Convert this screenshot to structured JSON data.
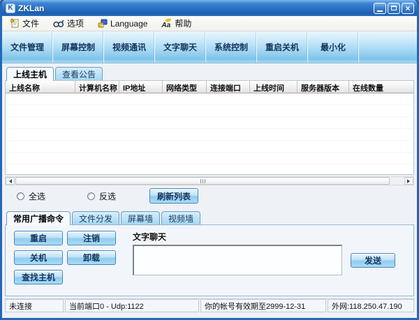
{
  "window": {
    "title": "ZKLan",
    "icon": "app-logo-K"
  },
  "titlebar": {
    "controls": [
      "minimize",
      "restore",
      "close"
    ]
  },
  "menu": {
    "items": [
      {
        "label": "文件",
        "icon": "document-icon"
      },
      {
        "label": "选项",
        "icon": "binoculars-icon"
      },
      {
        "label": "Language",
        "icon": "language-switch-icon"
      },
      {
        "label": "帮助",
        "icon": "font-key-icon"
      }
    ]
  },
  "toolbar": {
    "buttons": [
      "文件管理",
      "屏幕控制",
      "视频通讯",
      "文字聊天",
      "系统控制",
      "重启关机",
      "最小化"
    ]
  },
  "upper_tabs": [
    {
      "label": "上线主机",
      "active": true
    },
    {
      "label": "查看公告",
      "active": false
    }
  ],
  "table": {
    "columns": [
      "上线名称",
      "计算机名称",
      "IP地址",
      "网络类型",
      "连接端口",
      "上线时间",
      "服务器版本",
      "在线数量"
    ],
    "rows": []
  },
  "selection": {
    "radio_all": "全选",
    "radio_invert": "反选",
    "refresh_button": "刷新列表"
  },
  "lower_tabs": [
    {
      "label": "常用广播命令",
      "active": true
    },
    {
      "label": "文件分发",
      "active": false
    },
    {
      "label": "屏幕墙",
      "active": false
    },
    {
      "label": "视频墙",
      "active": false
    }
  ],
  "broadcast": {
    "buttons": [
      "重启",
      "注销",
      "关机",
      "卸载",
      "查找主机"
    ],
    "chat_label": "文字聊天",
    "chat_value": "",
    "send_button": "发送"
  },
  "statusbar": {
    "segments": [
      "未连接",
      "当前端口0 - Udp:1122",
      "你的帐号有效期至2999-12-31",
      "外网:118.250.47.190"
    ]
  },
  "colors": {
    "title_bar_blue": "#2a70c2",
    "window_border_blue": "#2468b8",
    "toolbar_blue": "#9ed5f1",
    "button_text_navy": "#14335e"
  }
}
